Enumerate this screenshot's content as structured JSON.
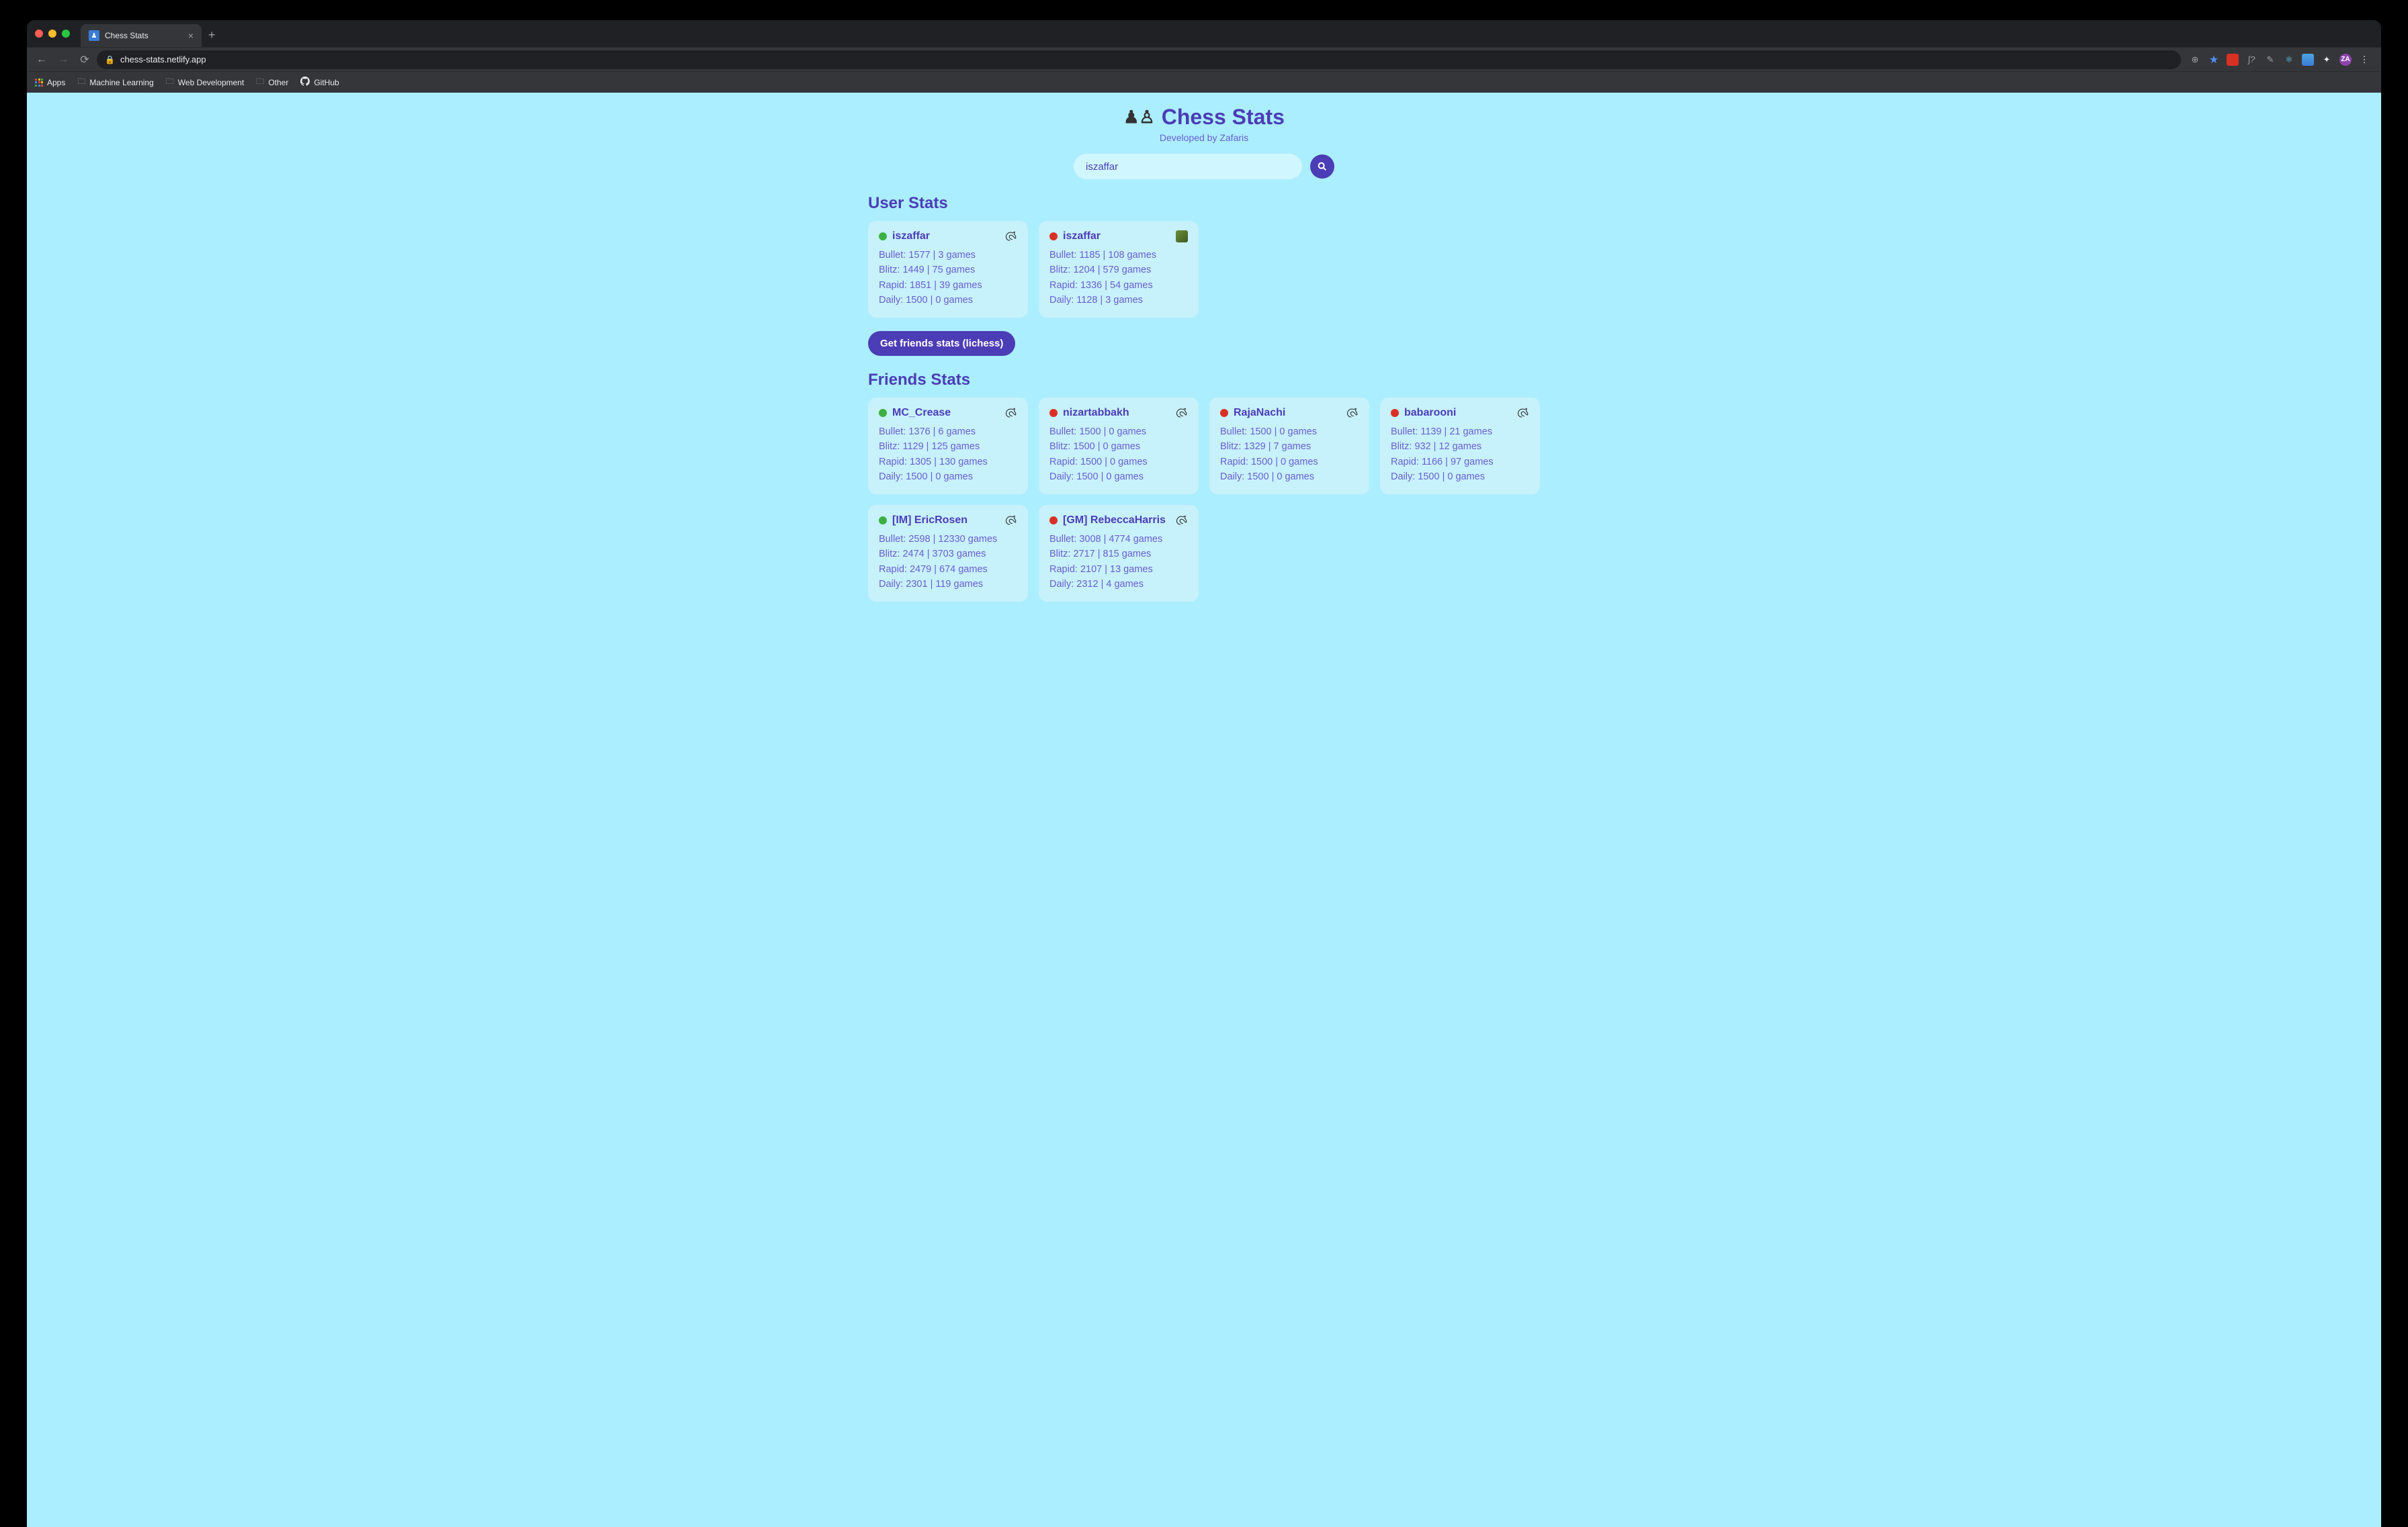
{
  "browser": {
    "tab_title": "Chess Stats",
    "url": "chess-stats.netlify.app",
    "bookmarks": {
      "apps": "Apps",
      "ml": "Machine Learning",
      "web": "Web Development",
      "other": "Other",
      "github": "GitHub"
    },
    "avatar_initials": "ZA"
  },
  "page": {
    "title": "Chess Stats",
    "subtitle": "Developed by Zafaris",
    "search_value": "iszaffar",
    "user_stats_title": "User Stats",
    "friends_stats_title": "Friends Stats",
    "friends_button": "Get friends stats (lichess)"
  },
  "user_cards": [
    {
      "username": "iszaffar",
      "status": "online",
      "platform": "lichess",
      "stats": {
        "bullet": "Bullet: 1577 | 3 games",
        "blitz": "Blitz: 1449 | 75 games",
        "rapid": "Rapid: 1851 | 39 games",
        "daily": "Daily: 1500 | 0 games"
      }
    },
    {
      "username": "iszaffar",
      "status": "offline",
      "platform": "chesscom",
      "stats": {
        "bullet": "Bullet: 1185 | 108 games",
        "blitz": "Blitz: 1204 | 579 games",
        "rapid": "Rapid: 1336 | 54 games",
        "daily": "Daily: 1128 | 3 games"
      }
    }
  ],
  "friend_cards": [
    {
      "username": "MC_Crease",
      "status": "online",
      "platform": "lichess",
      "stats": {
        "bullet": "Bullet: 1376 | 6 games",
        "blitz": "Blitz: 1129 | 125 games",
        "rapid": "Rapid: 1305 | 130 games",
        "daily": "Daily: 1500 | 0 games"
      }
    },
    {
      "username": "nizartabbakh",
      "status": "offline",
      "platform": "lichess",
      "stats": {
        "bullet": "Bullet: 1500 | 0 games",
        "blitz": "Blitz: 1500 | 0 games",
        "rapid": "Rapid: 1500 | 0 games",
        "daily": "Daily: 1500 | 0 games"
      }
    },
    {
      "username": "RajaNachi",
      "status": "offline",
      "platform": "lichess",
      "stats": {
        "bullet": "Bullet: 1500 | 0 games",
        "blitz": "Blitz: 1329 | 7 games",
        "rapid": "Rapid: 1500 | 0 games",
        "daily": "Daily: 1500 | 0 games"
      }
    },
    {
      "username": "babarooni",
      "status": "offline",
      "platform": "lichess",
      "stats": {
        "bullet": "Bullet: 1139 | 21 games",
        "blitz": "Blitz: 932 | 12 games",
        "rapid": "Rapid: 1166 | 97 games",
        "daily": "Daily: 1500 | 0 games"
      }
    },
    {
      "username": "[IM] EricRosen",
      "status": "online",
      "platform": "lichess",
      "stats": {
        "bullet": "Bullet: 2598 | 12330 games",
        "blitz": "Blitz: 2474 | 3703 games",
        "rapid": "Rapid: 2479 | 674 games",
        "daily": "Daily: 2301 | 119 games"
      }
    },
    {
      "username": "[GM] RebeccaHarris",
      "status": "offline",
      "platform": "lichess",
      "stats": {
        "bullet": "Bullet: 3008 | 4774 games",
        "blitz": "Blitz: 2717 | 815 games",
        "rapid": "Rapid: 2107 | 13 games",
        "daily": "Daily: 2312 | 4 games"
      }
    }
  ]
}
